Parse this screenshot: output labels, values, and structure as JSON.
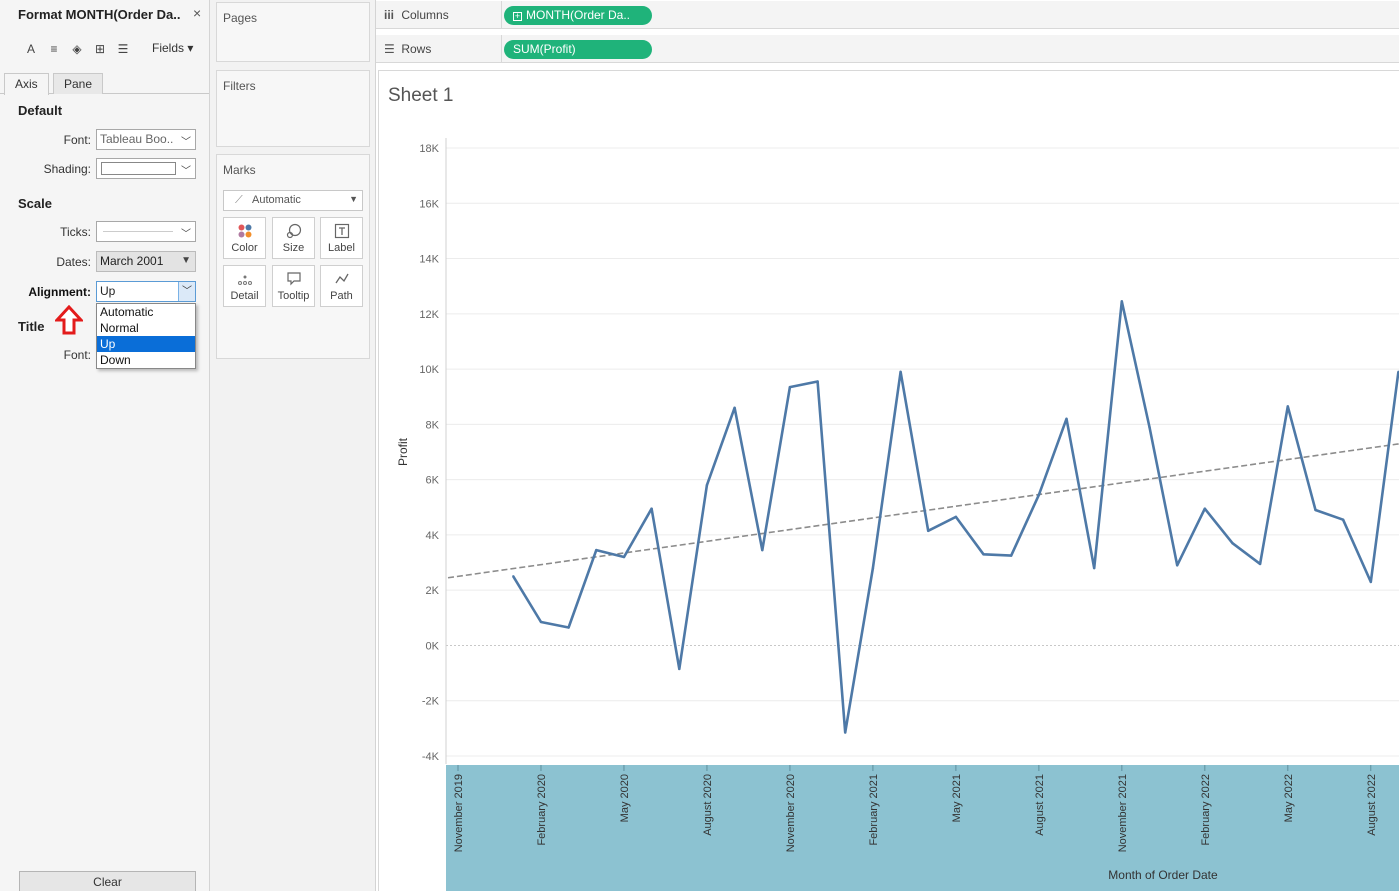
{
  "format_panel": {
    "title": "Format MONTH(Order Da..",
    "close_glyph": "×",
    "toolbar": {
      "font_glyph": "A",
      "align_glyph": "≡",
      "fill_glyph": "◈",
      "border_glyph": "⊞",
      "lines_glyph": "☰"
    },
    "fields_label": "Fields",
    "tabs": [
      "Axis",
      "Pane"
    ],
    "default_section": "Default",
    "font_label": "Font:",
    "font_value": "Tableau Boo..",
    "shading_label": "Shading:",
    "scale_section": "Scale",
    "ticks_label": "Ticks:",
    "dates_label": "Dates:",
    "dates_value": "March 2001",
    "alignment_label": "Alignment:",
    "alignment_value": "Up",
    "alignment_options": [
      "Automatic",
      "Normal",
      "Up",
      "Down"
    ],
    "alignment_selected": "Up",
    "title_section": "Title",
    "title_font_label": "Font:",
    "clear_label": "Clear",
    "annotation_arrow_color": "#e31b1b"
  },
  "cards": {
    "pages_title": "Pages",
    "filters_title": "Filters",
    "marks_title": "Marks",
    "marks_type": "Automatic",
    "mark_buttons": [
      {
        "label": "Color",
        "icon": "color-dots-icon"
      },
      {
        "label": "Size",
        "icon": "size-icon"
      },
      {
        "label": "Label",
        "icon": "label-icon"
      },
      {
        "label": "Detail",
        "icon": "detail-icon"
      },
      {
        "label": "Tooltip",
        "icon": "tooltip-icon"
      },
      {
        "label": "Path",
        "icon": "path-icon"
      }
    ]
  },
  "shelves": {
    "columns_label": "Columns",
    "columns_pill": "MONTH(Order Da..",
    "rows_label": "Rows",
    "rows_pill": "SUM(Profit)",
    "pill_color": "#1fb37a"
  },
  "sheet": {
    "title": "Sheet 1"
  },
  "chart_data": {
    "type": "line",
    "title": "Sheet 1",
    "xlabel": "Month of Order Date",
    "ylabel": "Profit",
    "ylim": [
      -4000,
      18000
    ],
    "y_ticks": [
      "-4K",
      "-2K",
      "0K",
      "2K",
      "4K",
      "6K",
      "8K",
      "10K",
      "12K",
      "14K",
      "16K",
      "18K"
    ],
    "x_tick_labels": [
      "November 2019",
      "February 2020",
      "May 2020",
      "August 2020",
      "November 2020",
      "February 2021",
      "May 2021",
      "August 2021",
      "November 2021",
      "February 2022",
      "May 2022",
      "August 2022"
    ],
    "x": [
      "2020-01",
      "2020-02",
      "2020-03",
      "2020-04",
      "2020-05",
      "2020-06",
      "2020-07",
      "2020-08",
      "2020-09",
      "2020-10",
      "2020-11",
      "2020-12",
      "2021-01",
      "2021-02",
      "2021-03",
      "2021-04",
      "2021-05",
      "2021-06",
      "2021-07",
      "2021-08",
      "2021-09",
      "2021-10",
      "2021-11",
      "2021-12",
      "2022-01",
      "2022-02",
      "2022-03",
      "2022-04",
      "2022-05",
      "2022-06",
      "2022-07",
      "2022-08",
      "2022-09"
    ],
    "series": [
      {
        "values": [
          2500,
          850,
          650,
          3450,
          3200,
          4950,
          -850,
          5800,
          8600,
          3450,
          9350,
          9550,
          -3150,
          2800,
          9900,
          4150,
          4650,
          3300,
          3250,
          5450,
          8200,
          2800,
          12450,
          7900,
          2900,
          4950,
          3700,
          2950,
          8650,
          4900,
          4550,
          2300,
          9900
        ],
        "color": "#4e79a7"
      }
    ],
    "trend_line": {
      "start_value": 2450,
      "end_value": 7300,
      "color": "#8c8c8c",
      "style": "dashed"
    },
    "x_axis_band_color": "#8cc2d1",
    "grid": true
  }
}
